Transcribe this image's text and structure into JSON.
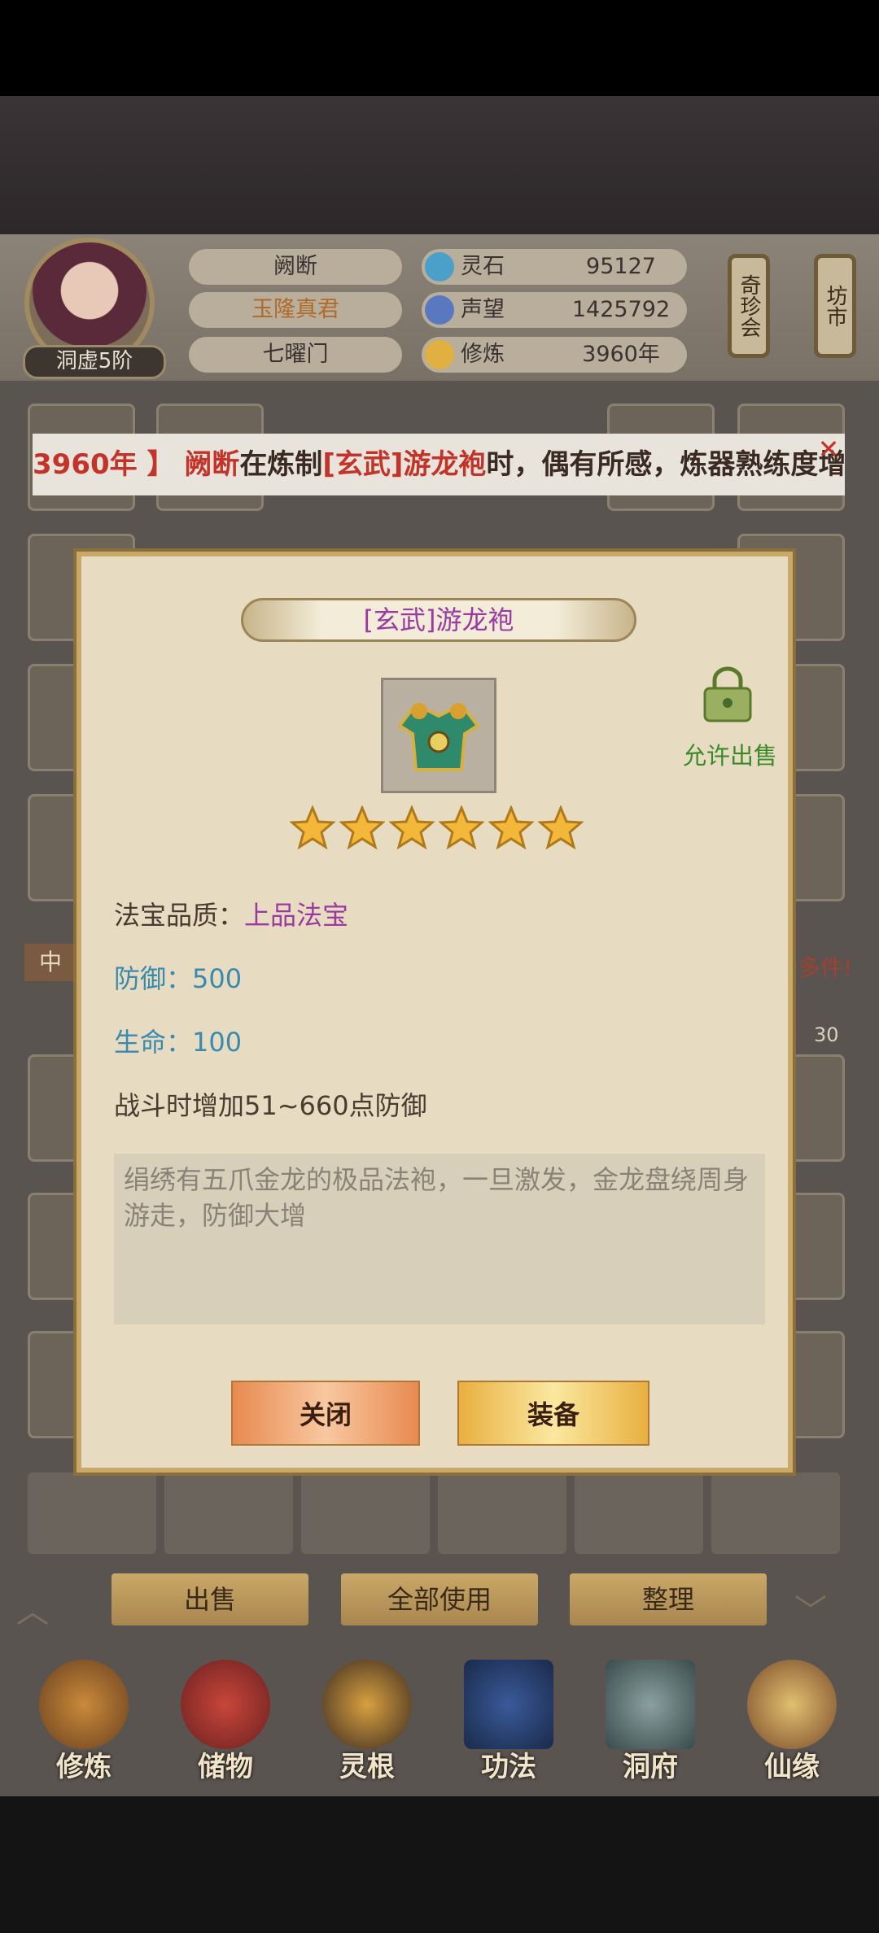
{
  "player": {
    "name": "阙断",
    "title": "玉隆真君",
    "sect": "七曜门",
    "realm": "洞虚5阶"
  },
  "resources": [
    {
      "label": "灵石",
      "value": "95127",
      "icon": "spirit-stone-icon"
    },
    {
      "label": "声望",
      "value": "1425792",
      "icon": "prestige-icon"
    },
    {
      "label": "修炼",
      "value": "3960年",
      "icon": "meditation-icon"
    }
  ],
  "side_buttons": {
    "treasure_fair": "奇珍会",
    "market": "坊市"
  },
  "ticker": {
    "part1": "3960年 】",
    "part2": "阙断",
    "part3": "在炼制",
    "part4": "[玄武]游龙袍",
    "part5": "时，偶有所感，炼器熟练度增加"
  },
  "background_hints": {
    "tab_partial": "中",
    "notice_partial": "多件!",
    "count": "30"
  },
  "modal": {
    "title": "[玄武]游龙袍",
    "sale_status": "允许出售",
    "stars": 6,
    "quality_label": "法宝品质：",
    "quality_value": "上品法宝",
    "defense": "防御：500",
    "life": "生命：100",
    "effect": "战斗时增加51~660点防御",
    "description": "绢绣有五爪金龙的极品法袍，一旦激发，金龙盘绕周身游走，防御大增",
    "close_button": "关闭",
    "equip_button": "装备"
  },
  "actions": {
    "sell": "出售",
    "use_all": "全部使用",
    "sort": "整理"
  },
  "nav_tabs": [
    {
      "label": "修炼",
      "icon": "cultivate-icon"
    },
    {
      "label": "储物",
      "icon": "storage-bag-icon"
    },
    {
      "label": "灵根",
      "icon": "spirit-root-icon"
    },
    {
      "label": "功法",
      "icon": "technique-book-icon"
    },
    {
      "label": "洞府",
      "icon": "cave-dwelling-icon"
    },
    {
      "label": "仙缘",
      "icon": "immortal-fate-icon"
    }
  ],
  "colors": {
    "title_purple": "#9b3aa0",
    "stat_blue": "#3a8ab0",
    "sale_green": "#3a8a2a",
    "ticker_red": "#c2342a"
  }
}
